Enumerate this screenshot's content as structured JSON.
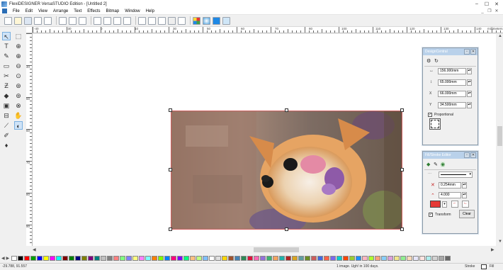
{
  "window": {
    "title": "FlexiDESIGNER VersaSTUDIO Edition - [Untitled 2]",
    "minimize": "–",
    "maximize": "☐",
    "close": "✕"
  },
  "menu": {
    "items": [
      "File",
      "Edit",
      "View",
      "Arrange",
      "Text",
      "Effects",
      "Bitmap",
      "Window",
      "Help"
    ],
    "mdi_minimize": "_",
    "mdi_restore": "❐",
    "mdi_close": "✕"
  },
  "ruler": {
    "units": "millimeters",
    "top_labels": [
      "-40",
      "-30",
      "0",
      "10",
      "20",
      "30",
      "50",
      "60",
      "70",
      "80",
      "90",
      "100",
      "110",
      "120",
      "130",
      "140"
    ],
    "left_labels": [
      "40",
      "50",
      "60",
      "70",
      "80",
      "90",
      "100"
    ]
  },
  "design_control": {
    "title": "DesignCentral",
    "width": "156.000mm",
    "height": "65.000mm",
    "x": "66.000mm",
    "y": "34.500mm",
    "proportional_label": "Proportional",
    "proportional_checked": true
  },
  "fill_stroke_editor": {
    "title": "Fill/Stroke Editor",
    "stroke_width": "0.254mm",
    "miter": "4.000",
    "transform_label": "Transform",
    "transform_checked": true,
    "clear_label": "Clear",
    "color": "#e53935"
  },
  "status": {
    "coords": "-29.788, 91.557",
    "message": "1 image. Ugh! in 100 days.",
    "stroke_label": "Stroke",
    "fill_label": "Fill"
  },
  "palette_colors": [
    "#ffffff",
    "#000000",
    "#ff0000",
    "#00a000",
    "#0000ff",
    "#ffff00",
    "#ff00ff",
    "#00ffff",
    "#800000",
    "#008000",
    "#000080",
    "#808000",
    "#800080",
    "#008080",
    "#c0c0c0",
    "#808080",
    "#ff8080",
    "#80ff80",
    "#8080ff",
    "#ffff80",
    "#ff80ff",
    "#80ffff",
    "#ff8000",
    "#80ff00",
    "#0080ff",
    "#ff0080",
    "#8000ff",
    "#00ff80",
    "#ffc080",
    "#c0ff80",
    "#80c0ff",
    "#ffffff",
    "#e0e0e0",
    "#ffd700",
    "#a0522d",
    "#4682b4",
    "#2e8b57",
    "#dc143c",
    "#ff69b4",
    "#9370db",
    "#3cb371",
    "#f4a460",
    "#20b2aa",
    "#b22222",
    "#daa520",
    "#5f9ea0",
    "#6b8e23",
    "#cd5c5c",
    "#4169e1",
    "#ff6347",
    "#7b68ee",
    "#00ced1",
    "#ff4500",
    "#9acd32",
    "#1e90ff",
    "#ffb6c1",
    "#adff2f",
    "#ffa07a",
    "#87cefa",
    "#dda0dd",
    "#f0e68c",
    "#90ee90",
    "#ffdab9",
    "#e6e6fa",
    "#ffe4e1",
    "#afeeee",
    "#d3d3d3",
    "#a9a9a9",
    "#696969"
  ]
}
